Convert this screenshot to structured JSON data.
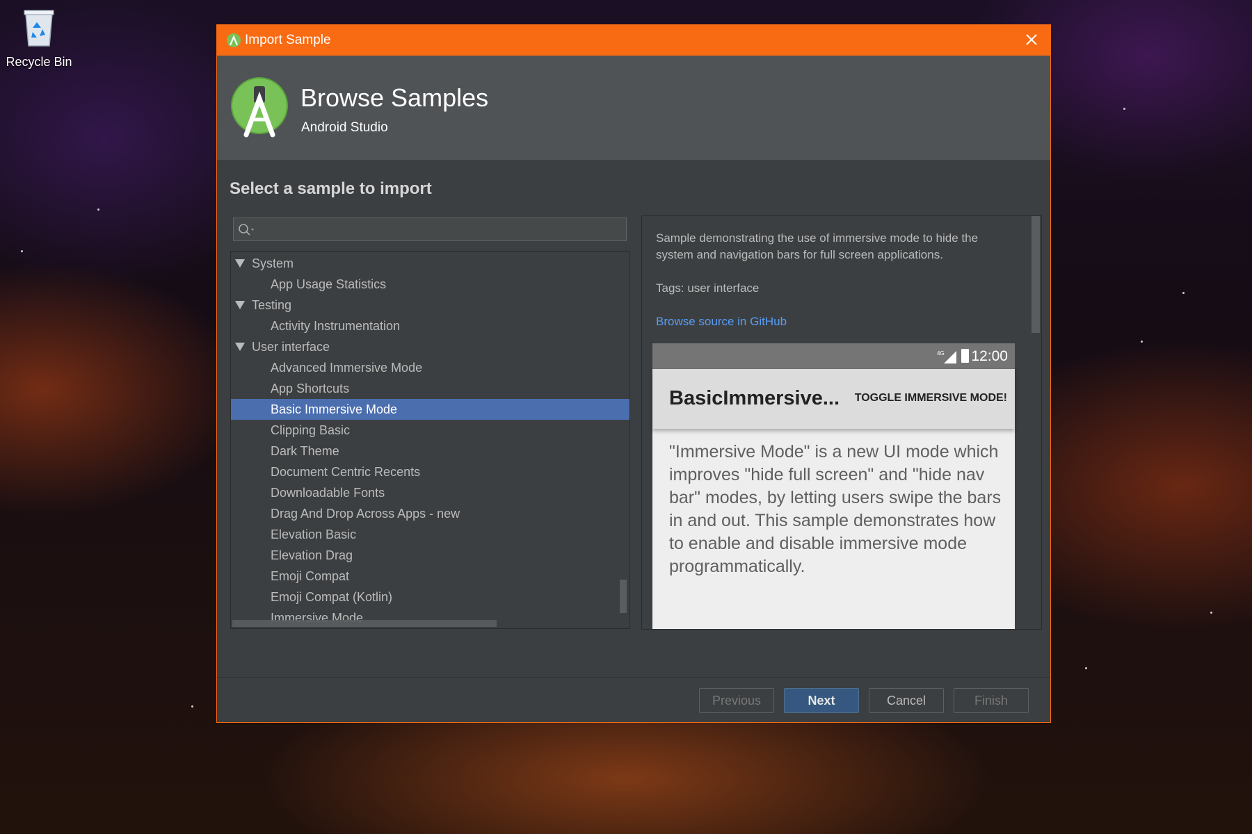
{
  "desktop": {
    "recycle_bin_label": "Recycle Bin"
  },
  "dialog": {
    "window_title": "Import Sample",
    "header_title": "Browse Samples",
    "header_subtitle": "Android Studio",
    "section_title": "Select a sample to import",
    "search": {
      "value": "",
      "placeholder": ""
    },
    "tree": [
      {
        "label": "System",
        "type": "category",
        "expanded": true
      },
      {
        "label": "App Usage Statistics",
        "type": "item"
      },
      {
        "label": "Testing",
        "type": "category",
        "expanded": true
      },
      {
        "label": "Activity Instrumentation",
        "type": "item"
      },
      {
        "label": "User interface",
        "type": "category",
        "expanded": true
      },
      {
        "label": "Advanced Immersive Mode",
        "type": "item"
      },
      {
        "label": "App Shortcuts",
        "type": "item"
      },
      {
        "label": "Basic Immersive Mode",
        "type": "item",
        "selected": true
      },
      {
        "label": "Clipping Basic",
        "type": "item"
      },
      {
        "label": "Dark Theme",
        "type": "item"
      },
      {
        "label": "Document Centric Recents",
        "type": "item"
      },
      {
        "label": "Downloadable Fonts",
        "type": "item"
      },
      {
        "label": "Drag And Drop Across Apps - new",
        "type": "item"
      },
      {
        "label": "Elevation Basic",
        "type": "item"
      },
      {
        "label": "Elevation Drag",
        "type": "item"
      },
      {
        "label": "Emoji Compat",
        "type": "item"
      },
      {
        "label": "Emoji Compat (Kotlin)",
        "type": "item"
      },
      {
        "label": "Immersive Mode",
        "type": "item"
      }
    ],
    "detail": {
      "description": "Sample demonstrating the use of immersive mode to hide the system and navigation bars for full screen applications.",
      "tags": "Tags: user interface",
      "github_link": "Browse source in GitHub",
      "preview": {
        "network": "4G",
        "time": "12:00",
        "app_title": "BasicImmersive...",
        "action": "TOGGLE IMMERSIVE MODE!",
        "body": "\"Immersive Mode\" is a new UI mode which improves \"hide full screen\" and \"hide nav bar\" modes, by letting users swipe the bars in and out. This sample demonstrates how to enable and disable immersive mode programmatically."
      }
    },
    "buttons": {
      "previous": "Previous",
      "next": "Next",
      "cancel": "Cancel",
      "finish": "Finish"
    }
  },
  "colors": {
    "accent_orange": "#f96b13",
    "selection_blue": "#4b6eaf",
    "link_blue": "#589df6",
    "android_green": "#78c257"
  }
}
